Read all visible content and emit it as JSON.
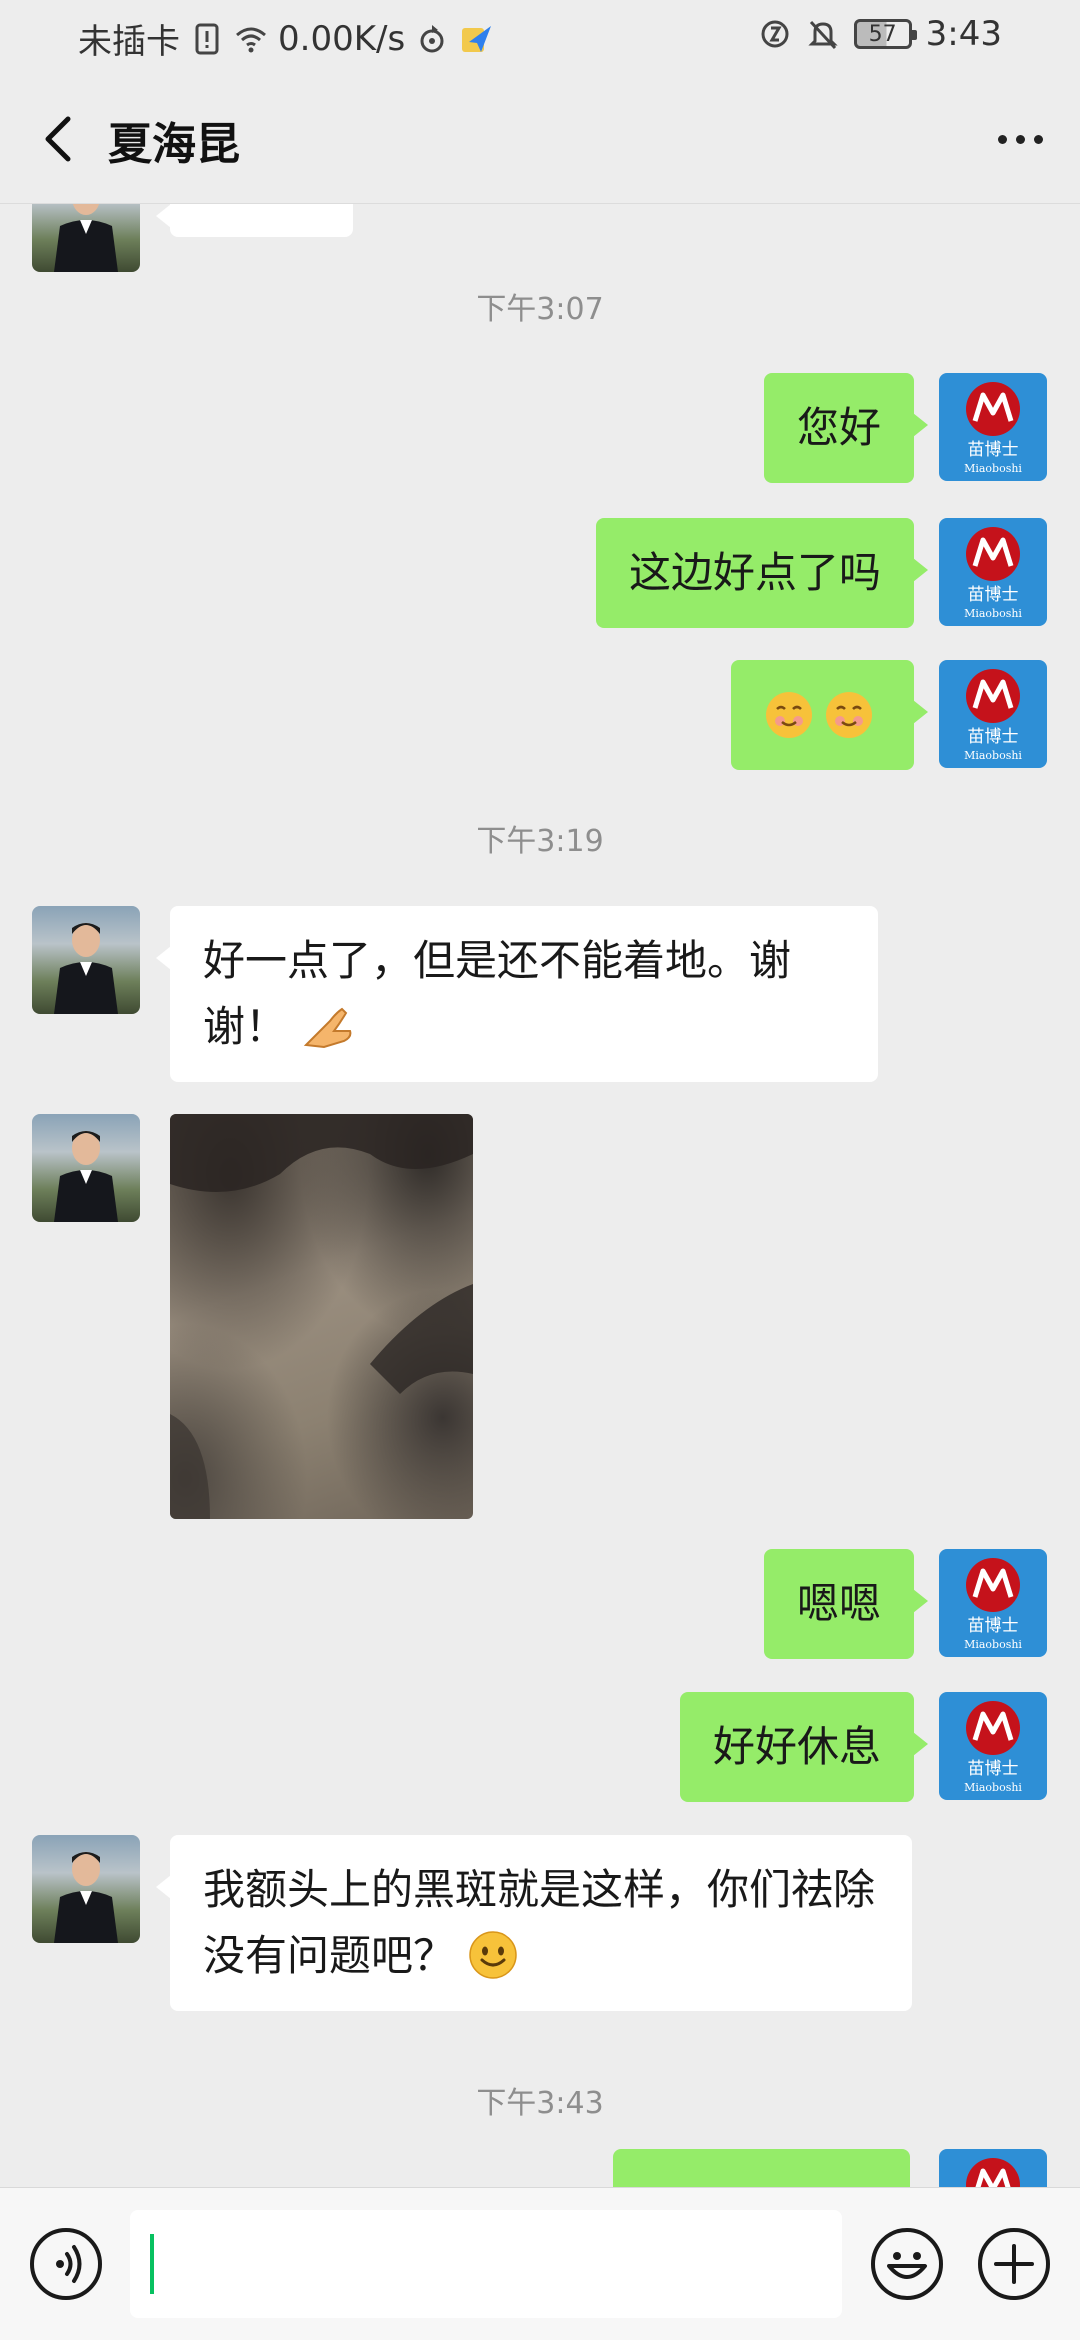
{
  "status_bar": {
    "carrier": "未插卡",
    "network_speed": "0.00K/s",
    "battery": "57",
    "time": "3:43"
  },
  "header": {
    "title": "夏海昆",
    "back_icon": "chevron-left-icon",
    "more_icon": "more-horizontal-icon"
  },
  "avatar_brand": {
    "text": "苗博士",
    "latin": "Miaoboshi"
  },
  "messages": {
    "time_1": "下午3:07",
    "m1": "您好",
    "m2": "这边好点了吗",
    "time_2": "下午3:19",
    "m4": "好一点了，但是还不能着地。谢谢！",
    "m6": "嗯嗯",
    "m7": "好好休息",
    "m8": "我额头上的黑斑就是这样，你们祛除没有问题吧？",
    "time_3": "下午3:43"
  },
  "colors": {
    "my_bubble": "#95ec69",
    "their_bubble": "#ffffff",
    "background": "#ededed",
    "brand_avatar": "#2e8fd6",
    "caret": "#07c160"
  },
  "input_bar": {
    "voice_icon": "voice-icon",
    "emoji_icon": "emoji-face-icon",
    "plus_icon": "plus-circle-icon",
    "text_value": ""
  }
}
